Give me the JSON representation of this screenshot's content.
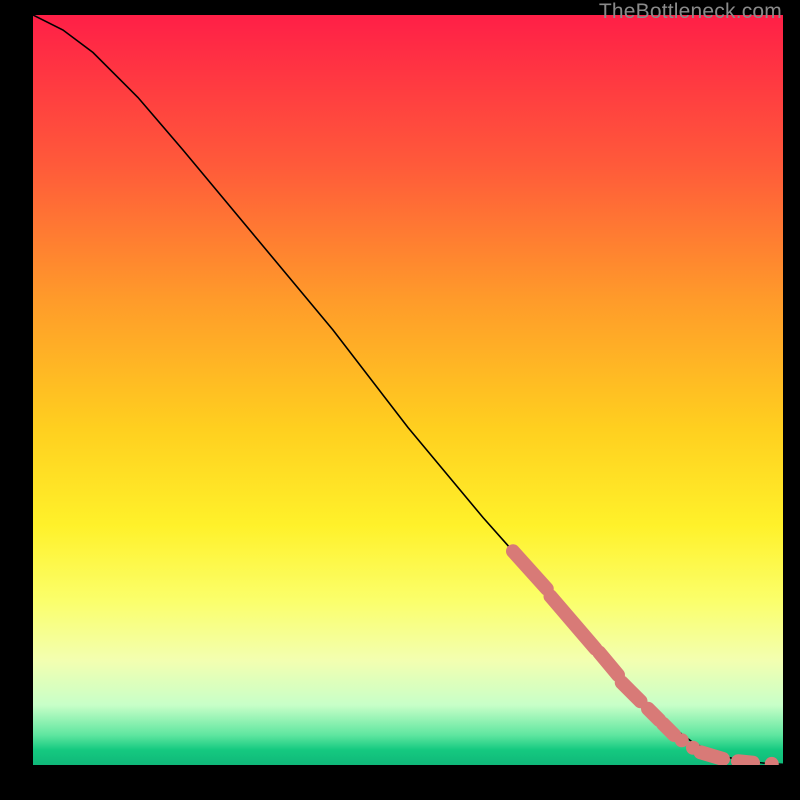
{
  "watermark": "TheBottleneck.com",
  "chart_data": {
    "type": "line",
    "title": "",
    "xlabel": "",
    "ylabel": "",
    "xlim": [
      0,
      100
    ],
    "ylim": [
      0,
      100
    ],
    "legend": false,
    "grid": false,
    "series": [
      {
        "name": "curve",
        "x": [
          0,
          4,
          8,
          14,
          20,
          30,
          40,
          50,
          60,
          68,
          74,
          78,
          82,
          86,
          88,
          90,
          92,
          94,
          96,
          98,
          100
        ],
        "y": [
          100,
          98,
          95,
          89,
          82,
          70,
          58,
          45,
          33,
          24,
          17,
          12,
          8,
          4.5,
          3,
          2,
          1.2,
          0.7,
          0.4,
          0.2,
          0.1
        ]
      }
    ],
    "markers": {
      "pills": [
        {
          "x0": 64,
          "y0": 28.5,
          "x1": 68.5,
          "y1": 23.5
        },
        {
          "x0": 69,
          "y0": 22.5,
          "x1": 75,
          "y1": 15.5
        },
        {
          "x0": 75.5,
          "y0": 15,
          "x1": 78,
          "y1": 12
        },
        {
          "x0": 78.5,
          "y0": 11,
          "x1": 81,
          "y1": 8.5
        },
        {
          "x0": 82,
          "y0": 7.5,
          "x1": 83.5,
          "y1": 6
        },
        {
          "x0": 84,
          "y0": 5.5,
          "x1": 85.5,
          "y1": 4
        },
        {
          "x0": 89,
          "y0": 1.7,
          "x1": 92,
          "y1": 0.8
        },
        {
          "x0": 94,
          "y0": 0.5,
          "x1": 96,
          "y1": 0.3
        }
      ],
      "dots": [
        {
          "x": 86.5,
          "y": 3.3
        },
        {
          "x": 88,
          "y": 2.3
        },
        {
          "x": 98.5,
          "y": 0.15
        }
      ]
    },
    "background": {
      "type": "vertical-gradient",
      "stops": [
        {
          "pos": 0,
          "color": "#ff1f47"
        },
        {
          "pos": 55,
          "color": "#ffcf1f"
        },
        {
          "pos": 86,
          "color": "#f3ffb0"
        },
        {
          "pos": 100,
          "color": "#0fb879"
        }
      ]
    }
  }
}
